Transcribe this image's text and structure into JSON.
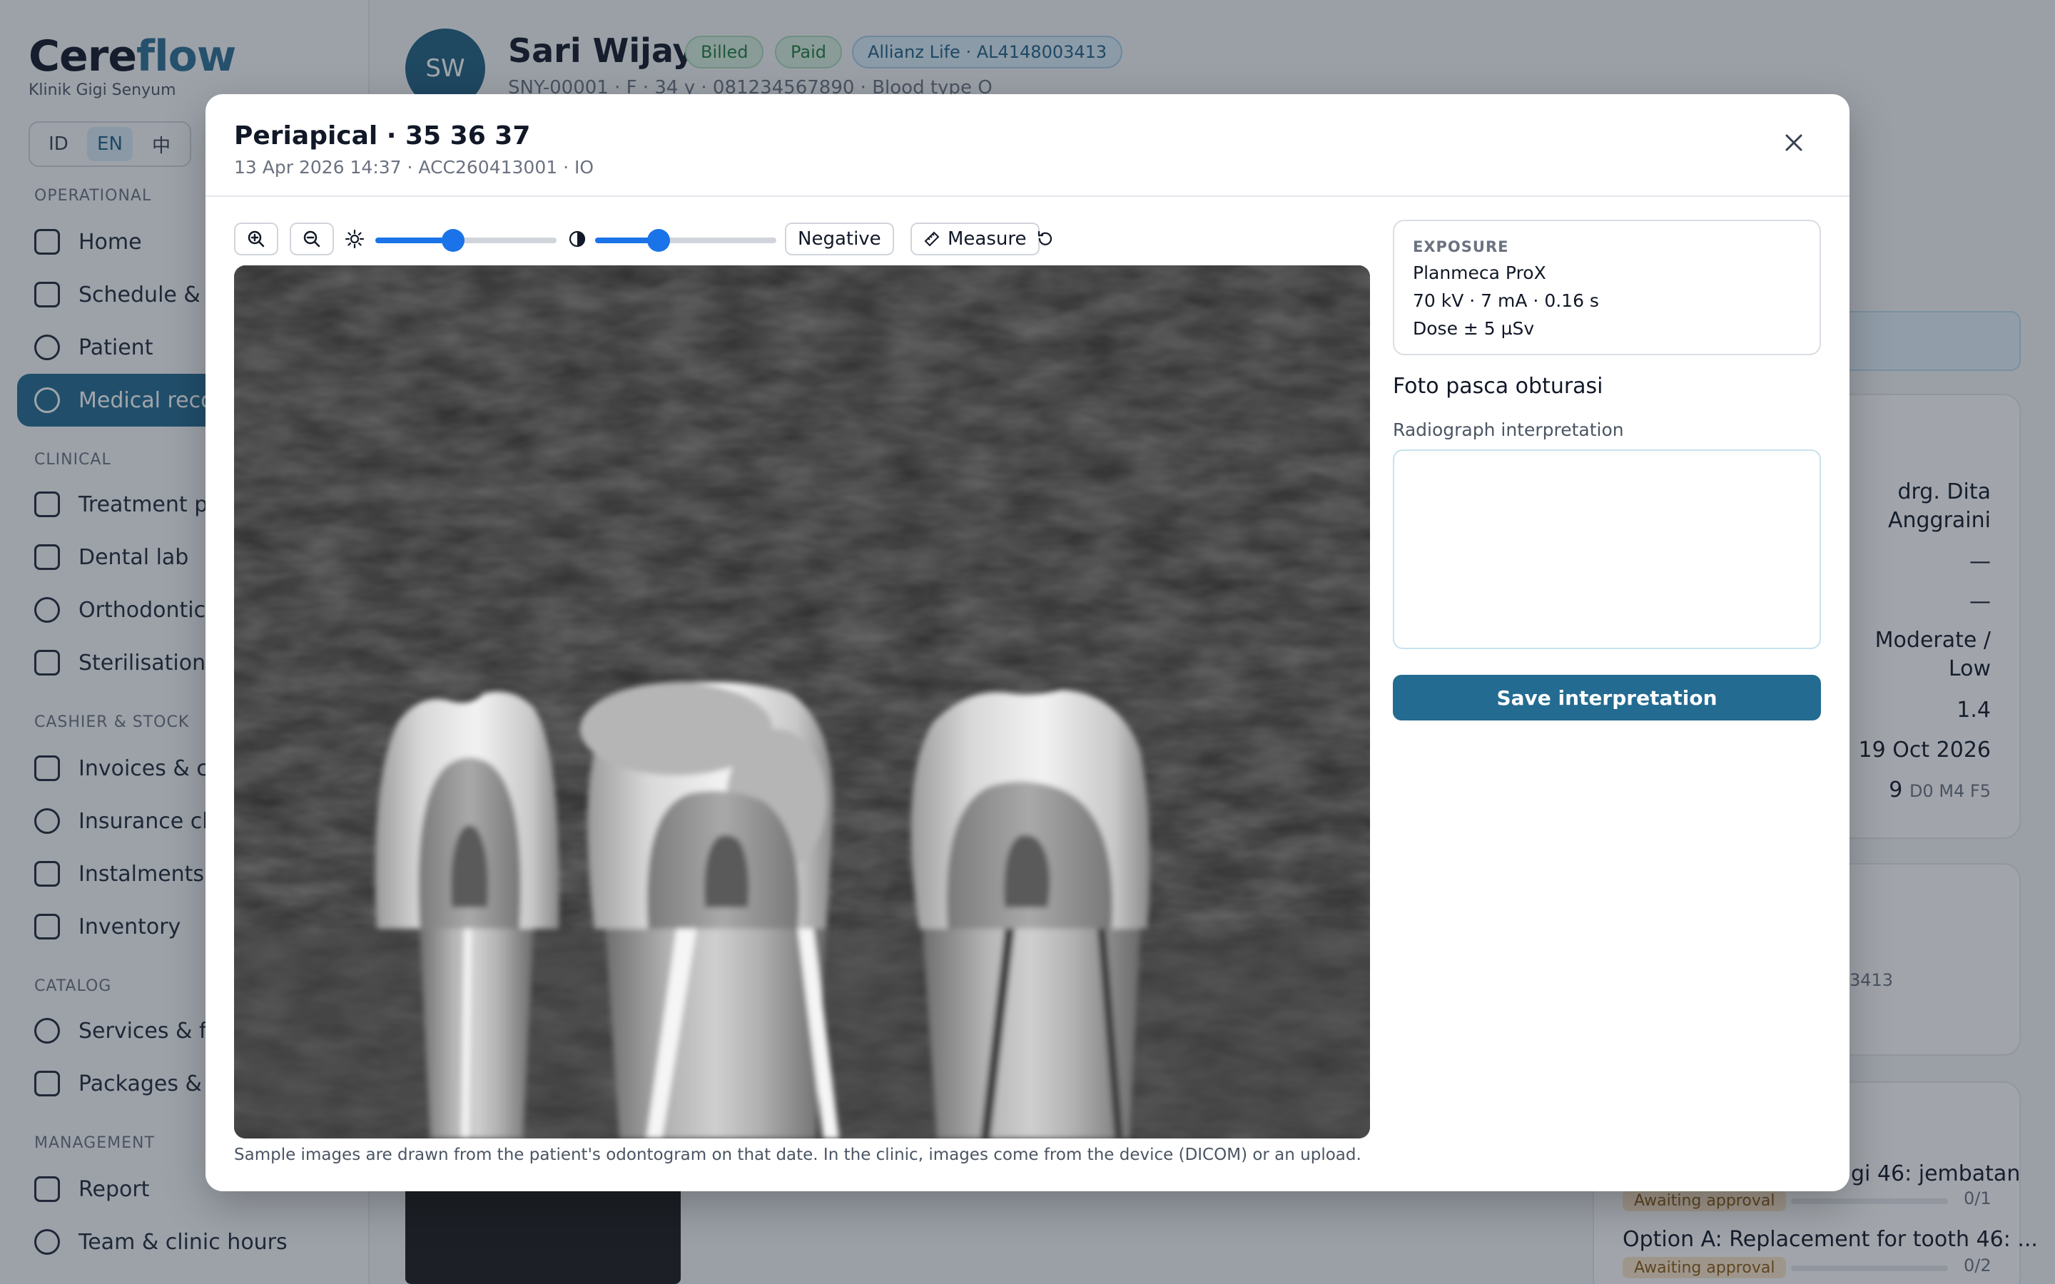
{
  "app": {
    "logo_main": "Cere",
    "logo_accent": "flow",
    "clinic": "Klinik Gigi Senyum",
    "languages": [
      "ID",
      "EN",
      "中"
    ],
    "active_language": "EN"
  },
  "sidebar": {
    "sections": {
      "operational": "OPERATIONAL",
      "clinical": "CLINICAL",
      "cashier": "CASHIER & STOCK",
      "catalog": "CATALOG",
      "management": "MANAGEMENT"
    },
    "items": [
      {
        "label": "Home",
        "icon": "grid-icon"
      },
      {
        "label": "Schedule & ch",
        "icon": "calendar-icon"
      },
      {
        "label": "Patient",
        "icon": "users-icon"
      },
      {
        "label": "Medical recor",
        "icon": "stethoscope-icon"
      },
      {
        "label": "Treatment pla",
        "icon": "clipboard-icon"
      },
      {
        "label": "Dental lab",
        "icon": "flask-icon"
      },
      {
        "label": "Orthodontics",
        "icon": "smile-icon"
      },
      {
        "label": "Sterilisation",
        "icon": "shield-icon"
      },
      {
        "label": "Invoices & cas",
        "icon": "dollar-icon"
      },
      {
        "label": "Insurance clai",
        "icon": "check-circle-icon"
      },
      {
        "label": "Instalments",
        "icon": "wallet-icon"
      },
      {
        "label": "Inventory",
        "icon": "boxes-icon"
      },
      {
        "label": "Services & fee",
        "icon": "sparkle-icon"
      },
      {
        "label": "Packages & p",
        "icon": "package-icon"
      },
      {
        "label": "Report",
        "icon": "bar-chart-icon"
      },
      {
        "label": "Team & clinic hours",
        "icon": "team-icon"
      }
    ]
  },
  "patient": {
    "initials": "SW",
    "name": "Sari Wijaya",
    "badge_billed": "Billed",
    "badge_paid": "Paid",
    "badge_insurance": "Allianz Life · AL4148003413",
    "meta": "SNY-00001 · F · 34 y · 081234567890 · Blood type O"
  },
  "background_panel": {
    "doctor_line1": "drg. Dita",
    "doctor_line2": "Anggraini",
    "dash1": "—",
    "dash2": "—",
    "risk_line1": "Moderate /",
    "risk_line2": "Low",
    "score": "1.4",
    "date": "19 Oct 2026",
    "dmf_value": "9",
    "dmf_detail": "D0 M4 F5",
    "policy_tail": "3413",
    "plan1_title": "gi 46: jembatan",
    "plan1_status": "Awaiting approval",
    "plan1_count": "0/1",
    "plan2_title": "Option A: Replacement for tooth 46: ...",
    "plan2_status": "Awaiting approval",
    "plan2_count": "0/2"
  },
  "modal": {
    "title": "Periapical · 35 36 37",
    "subtitle": "13 Apr 2026 14:37 · ACC260413001 · IO",
    "close_icon": "close-icon",
    "toolbar": {
      "negative_label": "Negative",
      "measure_label": "Measure",
      "brightness_level": 0.43,
      "contrast_level": 0.35
    },
    "caption": "Sample images are drawn from the patient's odontogram on that date. In the clinic, images come from the device (DICOM) or an upload.",
    "exposure": {
      "label": "EXPOSURE",
      "device": "Planmeca ProX",
      "settings": "70 kV · 7 mA · 0.16 s",
      "dose": "Dose ± 5 µSv"
    },
    "photo_note": "Foto pasca obturasi",
    "interpretation_label": "Radiograph interpretation",
    "interpretation_value": "",
    "save_label": "Save interpretation"
  },
  "colors": {
    "brand": "#246b91",
    "slider": "#1a73e8",
    "awaiting": "#fbe6c8"
  }
}
